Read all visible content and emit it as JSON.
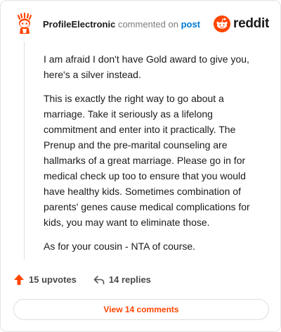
{
  "comment": {
    "username": "ProfileElectronic",
    "action_text": "commented on",
    "post_link": "post",
    "paragraphs": [
      "I am afraid I don't have Gold award to give you, here's a silver instead.",
      "This is exactly the right way to go about a marriage. Take it seriously as a lifelong commitment and enter into it practically. The Prenup and the pre-marital counseling are hallmarks of a great marriage. Please go in for medical check up too to ensure that you would have healthy kids. Sometimes combination of parents' genes cause medical complications for kids, you may want to eliminate those.",
      "As for your cousin - NTA of course."
    ]
  },
  "brand": {
    "wordmark": "reddit",
    "accent_color": "#ff4500"
  },
  "footer": {
    "upvotes": "15 upvotes",
    "replies": "14 replies",
    "view_comments": "View 14 comments"
  },
  "icons": {
    "avatar": "snoo-avatar-icon",
    "brand": "reddit-logo-icon",
    "upvote": "upvote-arrow-icon",
    "reply": "reply-arrow-icon"
  }
}
